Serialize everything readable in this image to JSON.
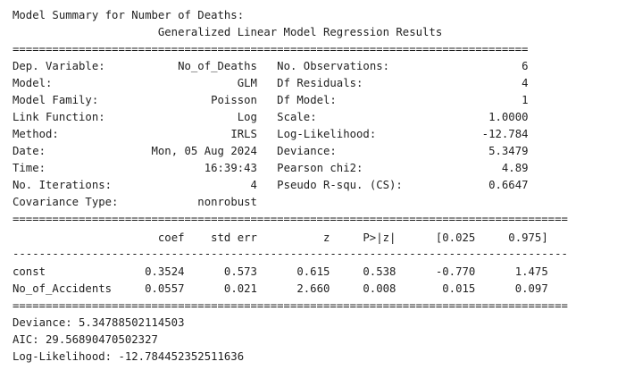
{
  "output": {
    "header": "Model Summary for Number of Deaths:",
    "title": "Generalized Linear Model Regression Results",
    "info_rows": [
      {
        "left_label": "Dep. Variable:",
        "left_value": "No_of_Deaths",
        "right_label": "No. Observations:",
        "right_value": "6"
      },
      {
        "left_label": "Model:",
        "left_value": "GLM",
        "right_label": "Df Residuals:",
        "right_value": "4"
      },
      {
        "left_label": "Model Family:",
        "left_value": "Poisson",
        "right_label": "Df Model:",
        "right_value": "1"
      },
      {
        "left_label": "Link Function:",
        "left_value": "Log",
        "right_label": "Scale:",
        "right_value": "1.0000"
      },
      {
        "left_label": "Method:",
        "left_value": "IRLS",
        "right_label": "Log-Likelihood:",
        "right_value": "-12.784"
      },
      {
        "left_label": "Date:",
        "left_value": "Mon, 05 Aug 2024",
        "right_label": "Deviance:",
        "right_value": "5.3479"
      },
      {
        "left_label": "Time:",
        "left_value": "16:39:43",
        "right_label": "Pearson chi2:",
        "right_value": "4.89"
      },
      {
        "left_label": "No. Iterations:",
        "left_value": "4",
        "right_label": "Pseudo R-squ. (CS):",
        "right_value": "0.6647"
      },
      {
        "left_label": "Covariance Type:",
        "left_value": "nonrobust",
        "right_label": "",
        "right_value": ""
      }
    ],
    "coef_columns": [
      "coef",
      "std err",
      "z",
      "P>|z|",
      "[0.025",
      "0.975]"
    ],
    "coef_rows": [
      {
        "name": "const",
        "values": [
          "0.3524",
          "0.573",
          "0.615",
          "0.538",
          "-0.770",
          "1.475"
        ]
      },
      {
        "name": "No_of_Accidents",
        "values": [
          "0.0557",
          "0.021",
          "2.660",
          "0.008",
          "0.015",
          "0.097"
        ]
      }
    ],
    "footer": [
      "Deviance: 5.34788502114503",
      "AIC: 29.56890470502327",
      "Log-Likelihood: -12.784452352511636"
    ]
  }
}
